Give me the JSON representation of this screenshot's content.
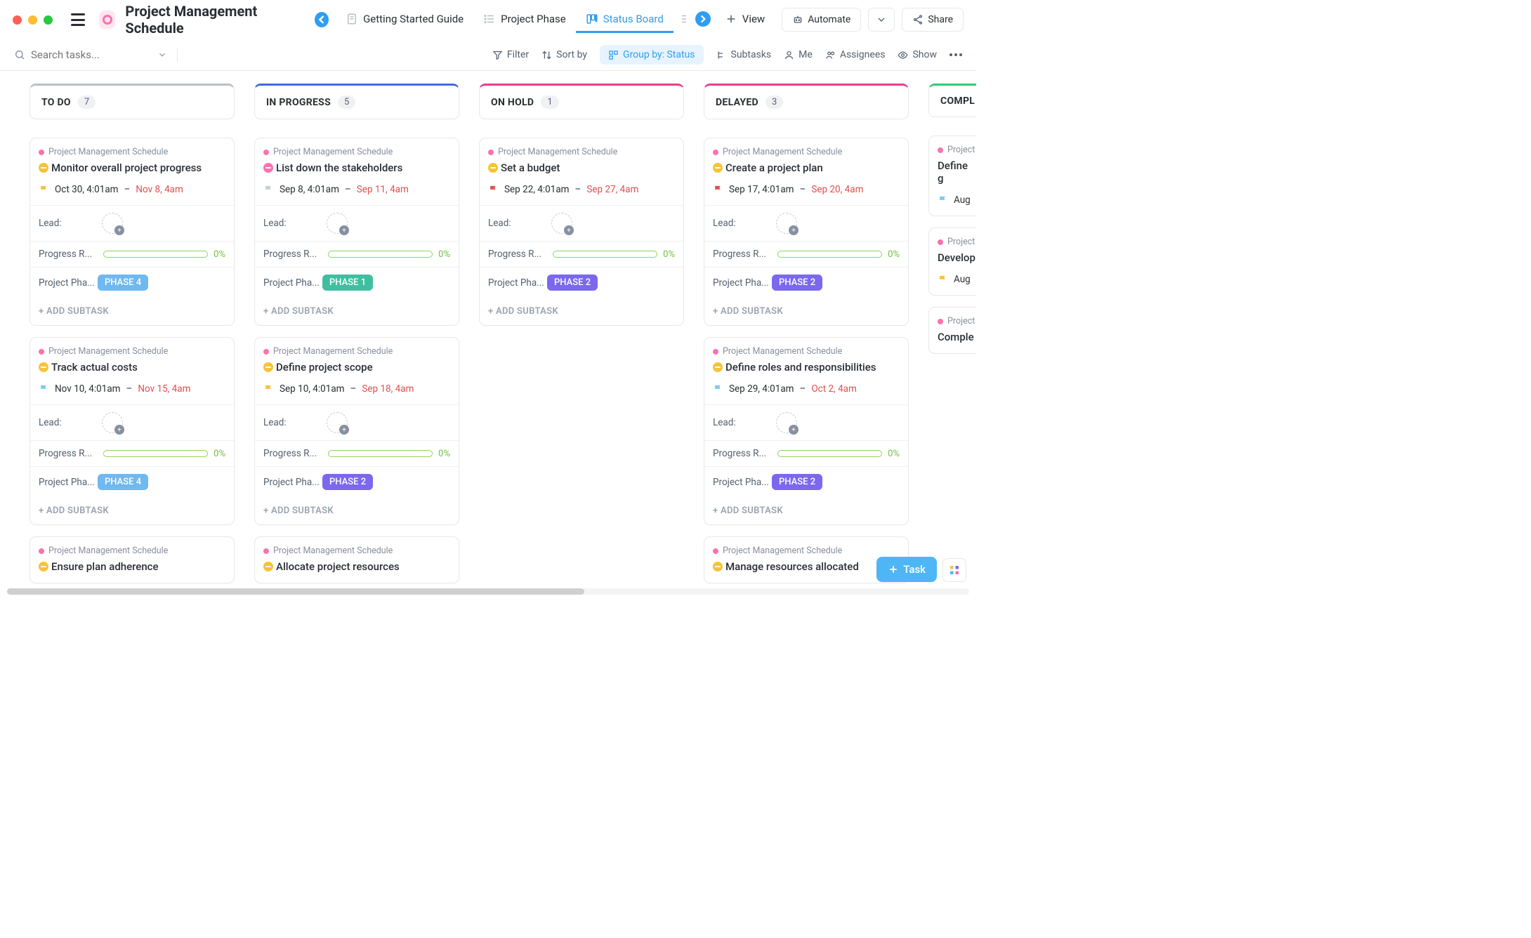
{
  "workspace": {
    "title": "Project Management Schedule"
  },
  "viewTabs": [
    {
      "label": "Getting Started Guide",
      "active": false
    },
    {
      "label": "Project Phase",
      "active": false
    },
    {
      "label": "Status Board",
      "active": true
    }
  ],
  "viewBtn": "View",
  "automateBtn": "Automate",
  "shareBtn": "Share",
  "search": {
    "placeholder": "Search tasks..."
  },
  "toolbar": {
    "filter": "Filter",
    "sort": "Sort by",
    "group": "Group by: Status",
    "subtasks": "Subtasks",
    "me": "Me",
    "assignees": "Assignees",
    "show": "Show"
  },
  "columns": [
    {
      "name": "TO DO",
      "count": 7,
      "color": "#b9bec7"
    },
    {
      "name": "IN PROGRESS",
      "count": 5,
      "color": "#4169e1"
    },
    {
      "name": "ON HOLD",
      "count": 1,
      "color": "#e83e8c"
    },
    {
      "name": "DELAYED",
      "count": 3,
      "color": "#e83e8c"
    },
    {
      "name": "COMPL",
      "count": null,
      "color": "#2ecc71"
    }
  ],
  "statusColors": {
    "todo": "#f5c33b",
    "inprog": "#fd71af",
    "hold": "#f5c33b",
    "delayed": "#f5c33b"
  },
  "flagColors": {
    "yellow": "#f5c33b",
    "grey": "#c7cdd4",
    "red": "#e04f4f",
    "blue": "#7ec8f5"
  },
  "phaseColors": {
    "PHASE 1": "#3fbfa0",
    "PHASE 2": "#7b68ee",
    "PHASE 4": "#6fb8f0"
  },
  "labels": {
    "lead": "Lead:",
    "progress": "Progress R...",
    "phase": "Project Pha...",
    "pct": "0%",
    "addSub": "+ ADD SUBTASK",
    "crumb": "Project Management Schedule",
    "crumbShort": "Project"
  },
  "fab": "Task",
  "cards": {
    "todo": [
      {
        "title": "Monitor overall project progress",
        "status": "todo",
        "flag": "yellow",
        "d1": "Oct 30, 4:01am",
        "d2": "Nov 8, 4am",
        "phase": "PHASE 4"
      },
      {
        "title": "Track actual costs",
        "status": "todo",
        "flag": "blue",
        "d1": "Nov 10, 4:01am",
        "d2": "Nov 15, 4am",
        "phase": "PHASE 4"
      },
      {
        "title": "Ensure plan adherence",
        "status": "todo",
        "partial": true
      }
    ],
    "inprog": [
      {
        "title": "List down the stakeholders",
        "status": "inprog",
        "flag": "grey",
        "d1": "Sep 8, 4:01am",
        "d2": "Sep 11, 4am",
        "phase": "PHASE 1"
      },
      {
        "title": "Define project scope",
        "status": "todo",
        "flag": "yellow",
        "d1": "Sep 10, 4:01am",
        "d2": "Sep 18, 4am",
        "phase": "PHASE 2"
      },
      {
        "title": "Allocate project resources",
        "status": "todo",
        "partial": true
      }
    ],
    "hold": [
      {
        "title": "Set a budget",
        "status": "hold",
        "flag": "red",
        "d1": "Sep 22, 4:01am",
        "d2": "Sep 27, 4am",
        "phase": "PHASE 2"
      }
    ],
    "delayed": [
      {
        "title": "Create a project plan",
        "status": "todo",
        "flag": "red",
        "d1": "Sep 17, 4:01am",
        "d2": "Sep 20, 4am",
        "phase": "PHASE 2"
      },
      {
        "title": "Define roles and responsibilities",
        "status": "todo",
        "flag": "blue",
        "d1": "Sep 29, 4:01am",
        "d2": "Oct 2, 4am",
        "phase": "PHASE 2"
      },
      {
        "title": "Manage resources allocated",
        "status": "todo",
        "partial": true
      }
    ],
    "compl": [
      {
        "title": "Define g",
        "flag": "blue",
        "d1": "Aug",
        "crumbShort": true
      },
      {
        "title": "Develop",
        "flag": "yellow",
        "d1": "Aug",
        "crumbShort": true
      },
      {
        "title": "Comple",
        "crumbShort": true,
        "partial": true
      }
    ]
  }
}
